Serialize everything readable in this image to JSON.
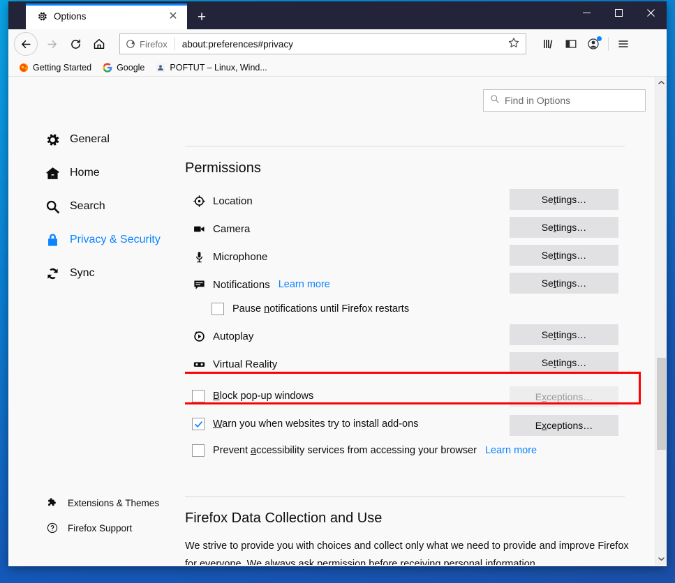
{
  "window": {
    "controls": {
      "minimize": "─",
      "maximize": "☐",
      "close": "✕"
    }
  },
  "tabbar": {
    "tab": {
      "title": "Options",
      "icon": "gear-icon",
      "close": "✕"
    },
    "new_tab": "+"
  },
  "navbar": {
    "back": "←",
    "forward": "→",
    "reload": "⟳",
    "home": "⌂",
    "identity_label": "Firefox",
    "url": "about:preferences#privacy",
    "star": "☆",
    "library_icon": "library-icon",
    "sidebar_icon": "sidebar-icon",
    "account_icon": "account-icon",
    "menu_icon": "hamburger-menu-icon"
  },
  "bookmarks": [
    {
      "label": "Getting Started",
      "icon": "firefox-icon"
    },
    {
      "label": "Google",
      "icon": "google-icon"
    },
    {
      "label": "POFTUT – Linux, Wind...",
      "icon": "site-icon"
    }
  ],
  "search": {
    "placeholder": "Find in Options",
    "icon": "search-icon"
  },
  "sidebar": {
    "items": [
      {
        "label": "General",
        "icon": "gear-icon",
        "selected": false
      },
      {
        "label": "Home",
        "icon": "home-icon",
        "selected": false
      },
      {
        "label": "Search",
        "icon": "search-icon",
        "selected": false
      },
      {
        "label": "Privacy & Security",
        "icon": "lock-icon",
        "selected": true
      },
      {
        "label": "Sync",
        "icon": "sync-icon",
        "selected": false
      }
    ],
    "bottom_items": [
      {
        "label": "Extensions & Themes",
        "icon": "puzzle-icon"
      },
      {
        "label": "Firefox Support",
        "icon": "help-icon"
      }
    ]
  },
  "main": {
    "permissions": {
      "title": "Permissions",
      "rows": [
        {
          "label": "Location",
          "icon": "location-icon",
          "button": "Settings…",
          "button_accesskey": "t"
        },
        {
          "label": "Camera",
          "icon": "camera-icon",
          "button": "Settings…",
          "button_accesskey": "t"
        },
        {
          "label": "Microphone",
          "icon": "microphone-icon",
          "button": "Settings…",
          "button_accesskey": "t"
        },
        {
          "label": "Notifications",
          "icon": "notification-icon",
          "link": "Learn more",
          "button": "Settings…",
          "button_accesskey": "t"
        },
        {
          "label": "Autoplay",
          "icon": "autoplay-icon",
          "button": "Settings…",
          "button_accesskey": "t"
        },
        {
          "label": "Virtual Reality",
          "icon": "vr-icon",
          "button": "Settings…",
          "button_accesskey": "t"
        }
      ],
      "pause_notifications": {
        "label_pre": "Pause ",
        "label_key": "n",
        "label_post": "otifications until Firefox restarts",
        "checked": false
      },
      "checkboxes": [
        {
          "label_pre": "",
          "label_key": "B",
          "label_post": "lock pop-up windows",
          "checked": false,
          "button": "Exceptions…",
          "button_disabled": true,
          "highlighted": true
        },
        {
          "label_pre": "",
          "label_key": "W",
          "label_post": "arn you when websites try to install add-ons",
          "checked": true,
          "button": "Exceptions…",
          "button_disabled": false,
          "highlighted": false
        },
        {
          "label_pre": "Prevent ",
          "label_key": "a",
          "label_post": "ccessibility services from accessing your browser",
          "checked": false,
          "link": "Learn more",
          "highlighted": false
        }
      ]
    },
    "data_collection": {
      "title": "Firefox Data Collection and Use",
      "paragraph": "We strive to provide you with choices and collect only what we need to provide and improve Firefox for everyone. We always ask permission before receiving personal information."
    }
  },
  "scrollbar": {
    "up": "▲",
    "down": "▼"
  },
  "colors": {
    "accent": "#0a84ff",
    "titlebar": "#232339",
    "highlight": "#ff0000",
    "page_bg": "#f9f9fa"
  }
}
